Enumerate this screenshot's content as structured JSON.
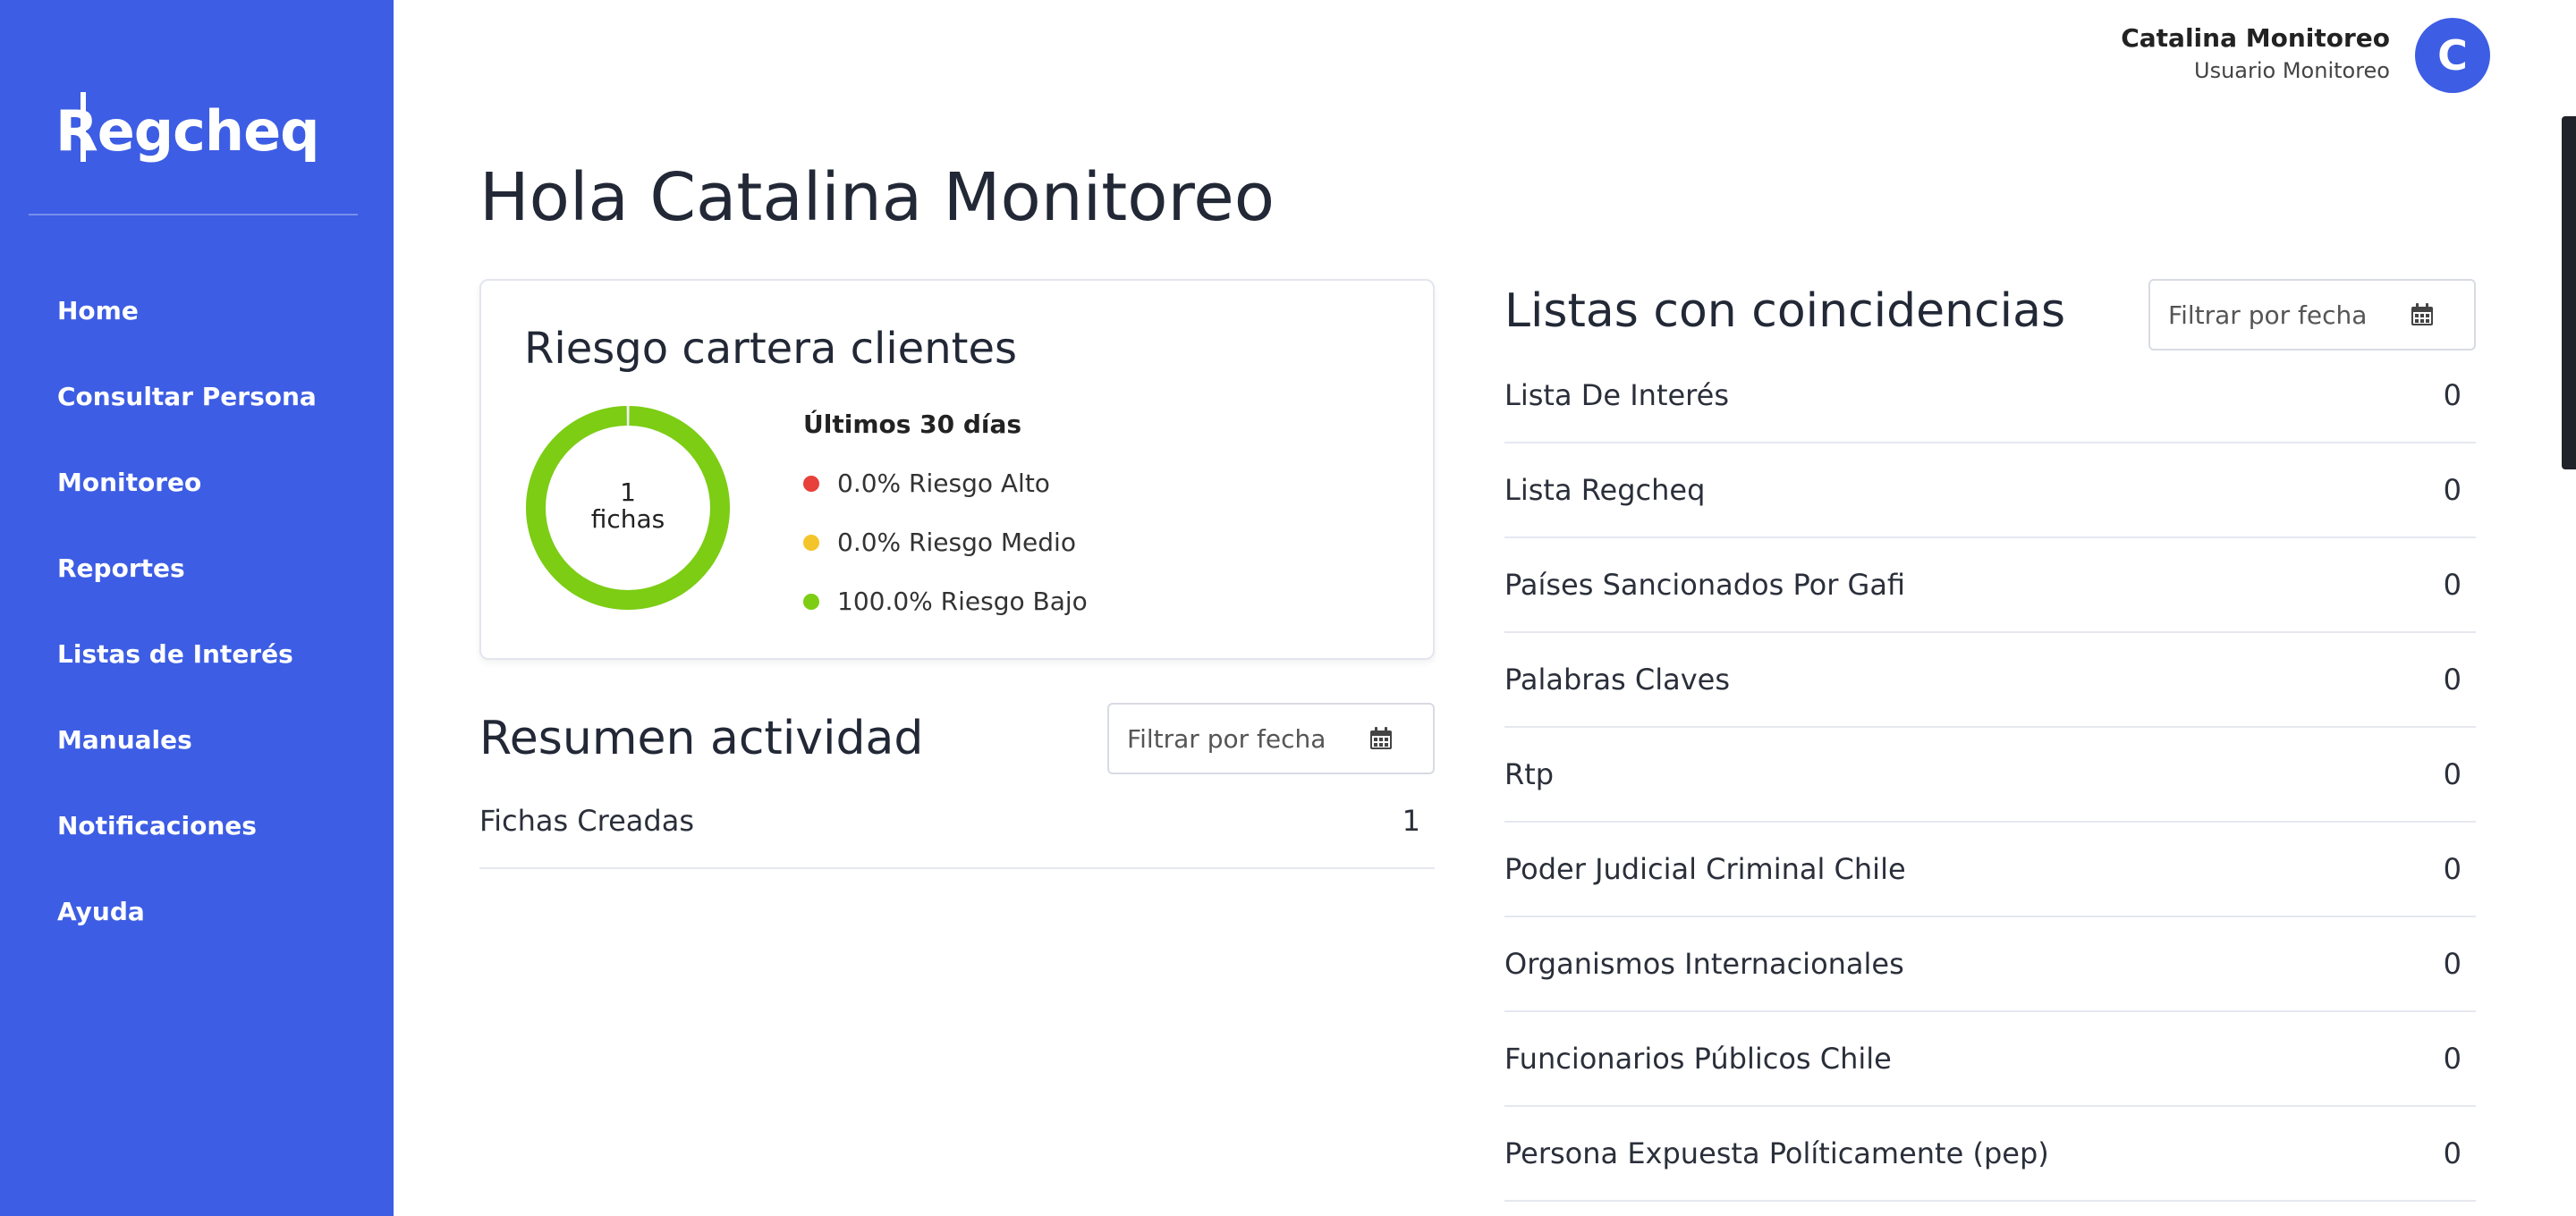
{
  "sidebar": {
    "logo_text": "Regcheq",
    "items": [
      {
        "label": "Home"
      },
      {
        "label": "Consultar Persona"
      },
      {
        "label": "Monitoreo"
      },
      {
        "label": "Reportes"
      },
      {
        "label": "Listas de Interés"
      },
      {
        "label": "Manuales"
      },
      {
        "label": "Notificaciones"
      },
      {
        "label": "Ayuda"
      }
    ],
    "color": "#3d5de4"
  },
  "header": {
    "user_name": "Catalina Monitoreo",
    "user_role": "Usuario Monitoreo",
    "avatar_initial": "C"
  },
  "page_title": "Hola Catalina Monitoreo",
  "risk_card": {
    "title": "Riesgo cartera clientes",
    "donut_count": "1",
    "donut_unit": "fichas",
    "period": "Últimos 30 días",
    "items": [
      {
        "label": "0.0% Riesgo Alto",
        "color": "#e8403a",
        "value": 0.0
      },
      {
        "label": "0.0% Riesgo Medio",
        "color": "#f4c52a",
        "value": 0.0
      },
      {
        "label": "100.0% Riesgo Bajo",
        "color": "#7ccd14",
        "value": 100.0
      }
    ]
  },
  "activity": {
    "title": "Resumen actividad",
    "filter_placeholder": "Filtrar por fecha",
    "rows": [
      {
        "label": "Fichas Creadas",
        "value": "1"
      }
    ]
  },
  "lists": {
    "title": "Listas con coincidencias",
    "filter_placeholder": "Filtrar por fecha",
    "rows": [
      {
        "label": "Lista De Interés",
        "value": "0"
      },
      {
        "label": "Lista Regcheq",
        "value": "0"
      },
      {
        "label": "Países Sancionados Por Gafi",
        "value": "0"
      },
      {
        "label": "Palabras Claves",
        "value": "0"
      },
      {
        "label": "Rtp",
        "value": "0"
      },
      {
        "label": "Poder Judicial Criminal Chile",
        "value": "0"
      },
      {
        "label": "Organismos Internacionales",
        "value": "0"
      },
      {
        "label": "Funcionarios Públicos Chile",
        "value": "0"
      },
      {
        "label": "Persona Expuesta Políticamente (pep)",
        "value": "0"
      }
    ]
  }
}
